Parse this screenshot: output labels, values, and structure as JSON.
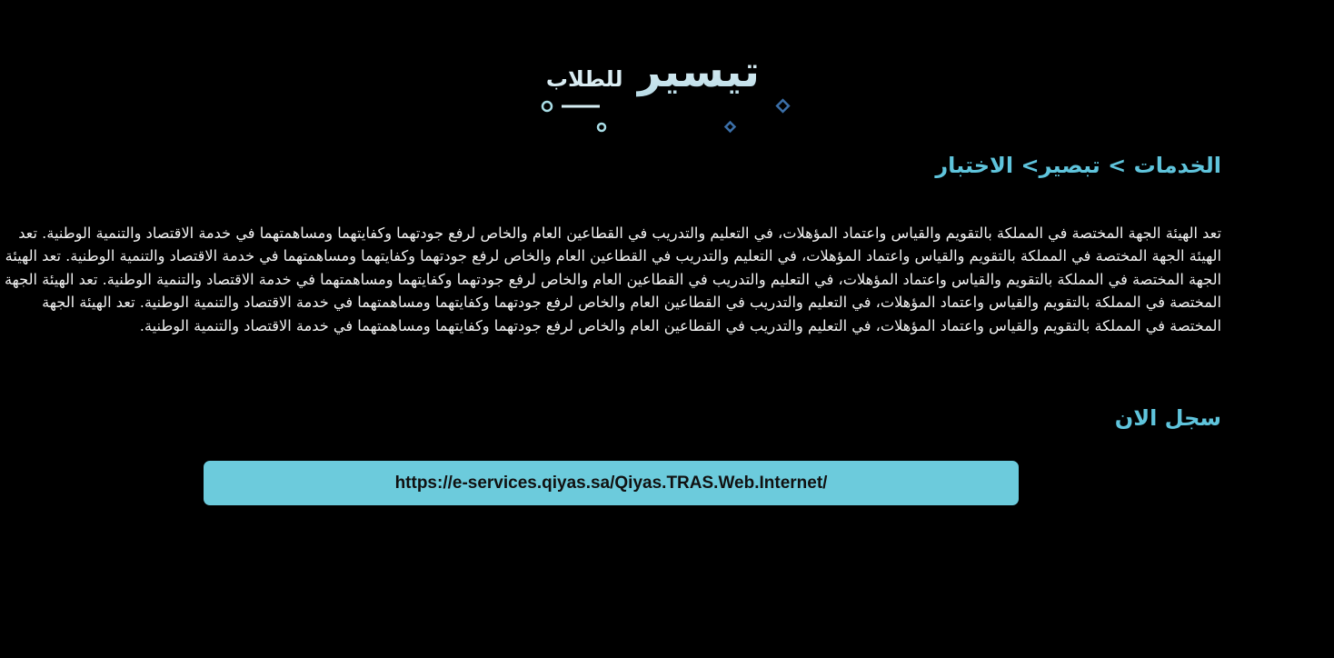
{
  "logo": {
    "brand_large": "تيسير",
    "brand_small": "للطلاب",
    "accent_color": "#5fc4dc"
  },
  "breadcrumb": {
    "text": "الخدمات > تبصير> الاختبار"
  },
  "description": {
    "text": "تعد الهيئة الجهة المختصة في المملكة بالتقويم والقياس واعتماد المؤهلات، في التعليم والتدريب في القطاعين العام والخاص لرفع جودتهما وكفايتهما ومساهمتهما في خدمة الاقتصاد والتنمية الوطنية. تعد الهيئة الجهة المختصة في المملكة بالتقويم والقياس واعتماد المؤهلات، في التعليم والتدريب في القطاعين العام والخاص لرفع جودتهما وكفايتهما ومساهمتهما في خدمة الاقتصاد والتنمية الوطنية. تعد الهيئة الجهة المختصة في المملكة بالتقويم والقياس واعتماد المؤهلات، في التعليم والتدريب في القطاعين العام والخاص لرفع جودتهما وكفايتهما ومساهمتهما في خدمة الاقتصاد والتنمية الوطنية. تعد الهيئة الجهة المختصة في المملكة بالتقويم والقياس واعتماد المؤهلات، في التعليم والتدريب في القطاعين العام والخاص لرفع جودتهما وكفايتهما ومساهمتهما في خدمة الاقتصاد والتنمية الوطنية. تعد الهيئة الجهة المختصة في المملكة بالتقويم والقياس واعتماد المؤهلات، في التعليم والتدريب في القطاعين العام والخاص لرفع جودتهما وكفايتهما ومساهمتهما في خدمة الاقتصاد والتنمية الوطنية."
  },
  "register": {
    "heading": "سجل الان",
    "link_text": "https://e-services.qiyas.sa/Qiyas.TRAS.Web.Internet/",
    "button_color": "#6ccbdc"
  }
}
